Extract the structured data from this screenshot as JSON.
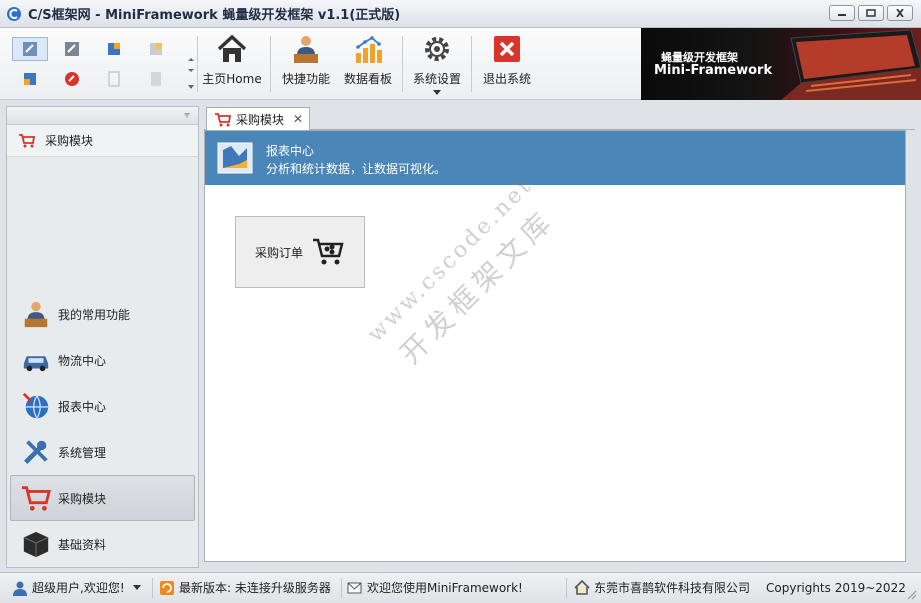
{
  "window": {
    "title": "C/S框架网 - MiniFramework 蝇量级开发框架 v1.1(正式版)"
  },
  "toolbar": {
    "buttons": [
      {
        "label": "主页Home",
        "icon": "home-icon"
      },
      {
        "label": "快捷功能",
        "icon": "person-desk-icon"
      },
      {
        "label": "数据看板",
        "icon": "bar-chart-icon"
      },
      {
        "label": "系统设置",
        "icon": "gear-icon"
      },
      {
        "label": "退出系统",
        "icon": "exit-icon"
      }
    ]
  },
  "banner": {
    "line1": "蝇量级开发框架",
    "line2": "Mini-Framework"
  },
  "sidebar": {
    "current_module": "采购模块",
    "items": [
      {
        "label": "我的常用功能",
        "icon": "person-desk-icon"
      },
      {
        "label": "物流中心",
        "icon": "car-icon"
      },
      {
        "label": "报表中心",
        "icon": "globe-icon"
      },
      {
        "label": "系统管理",
        "icon": "tools-icon"
      },
      {
        "label": "采购模块",
        "icon": "cart-icon",
        "active": true
      },
      {
        "label": "基础资料",
        "icon": "cube-icon"
      }
    ]
  },
  "tab": {
    "label": "采购模块"
  },
  "content": {
    "header_title": "报表中心",
    "header_subtitle": "分析和统计数据，让数据可视化。",
    "cards": [
      {
        "label": "采购订单",
        "icon": "cart-icon"
      }
    ],
    "watermark_line1": "www.cscode.net",
    "watermark_line2": "开发框架文库"
  },
  "status": {
    "user": "超级用户,欢迎您!",
    "version": "最新版本: 未连接升级服务器",
    "welcome": "欢迎您使用MiniFramework!",
    "company": "东莞市喜鹊软件科技有限公司",
    "copyright": "Copyrights 2019~2022"
  },
  "colors": {
    "header_band": "#4a86b8",
    "exit_red": "#d9342b",
    "cart_red": "#d8352a"
  }
}
